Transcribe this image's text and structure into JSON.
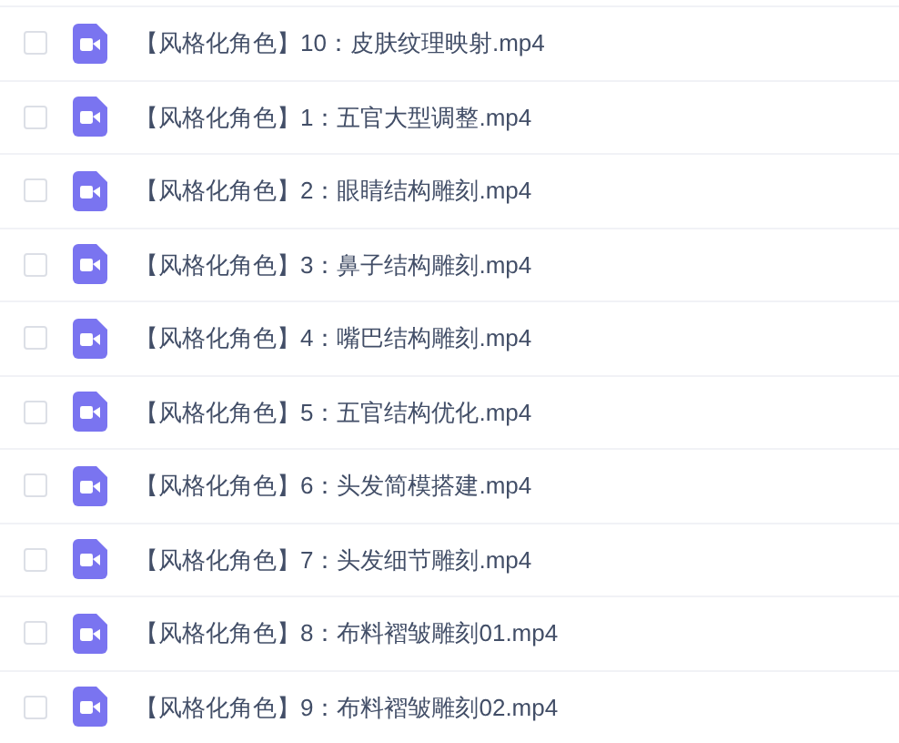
{
  "files": [
    {
      "name": "【风格化角色】10：皮肤纹理映射.mp4",
      "checked": false
    },
    {
      "name": "【风格化角色】1：五官大型调整.mp4",
      "checked": false
    },
    {
      "name": "【风格化角色】2：眼睛结构雕刻.mp4",
      "checked": false
    },
    {
      "name": "【风格化角色】3：鼻子结构雕刻.mp4",
      "checked": false
    },
    {
      "name": "【风格化角色】4：嘴巴结构雕刻.mp4",
      "checked": false
    },
    {
      "name": "【风格化角色】5：五官结构优化.mp4",
      "checked": false
    },
    {
      "name": "【风格化角色】6：头发简模搭建.mp4",
      "checked": false
    },
    {
      "name": "【风格化角色】7：头发细节雕刻.mp4",
      "checked": false
    },
    {
      "name": "【风格化角色】8：布料褶皱雕刻01.mp4",
      "checked": false
    },
    {
      "name": "【风格化角色】9：布料褶皱雕刻02.mp4",
      "checked": false
    }
  ]
}
